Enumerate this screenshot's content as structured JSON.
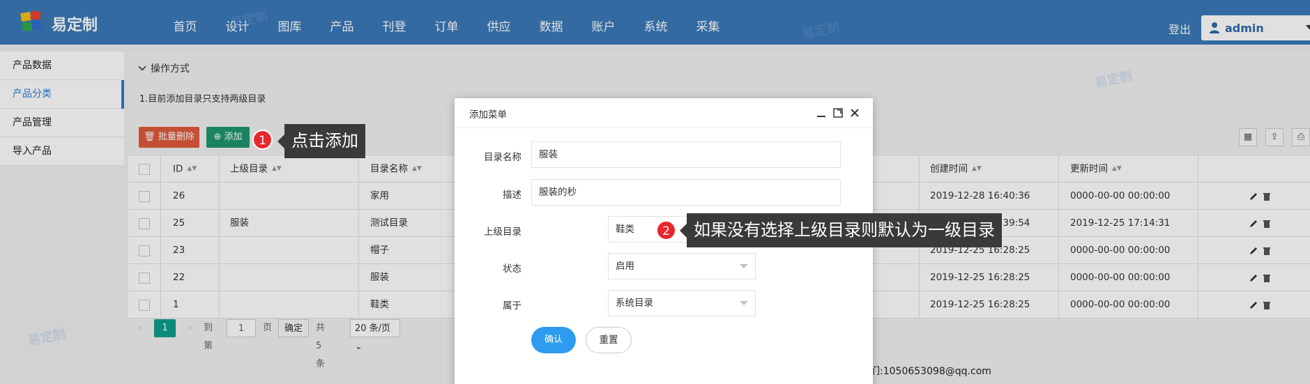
{
  "app": {
    "logo_text": "易定制"
  },
  "nav": {
    "items": [
      "首页",
      "设计",
      "图库",
      "产品",
      "刊登",
      "订单",
      "供应",
      "数据",
      "账户",
      "系统",
      "采集"
    ],
    "logout_label": "登出",
    "user_name": "admin"
  },
  "sidebar": {
    "items": [
      {
        "label": "产品数据"
      },
      {
        "label": "产品分类"
      },
      {
        "label": "产品管理"
      },
      {
        "label": "导入产品"
      }
    ]
  },
  "main": {
    "ops_title": "操作方式",
    "note": "1.目前添加目录只支持两级目录",
    "batch_delete_label": "批量删除",
    "add_label": "添加"
  },
  "table": {
    "headers": [
      "ID",
      "上级目录",
      "目录名称",
      "创建时间",
      "更新时间"
    ],
    "rows": [
      {
        "id": "26",
        "parent": "",
        "name": "家用",
        "created": "2019-12-28 16:40:36",
        "updated": "0000-00-00 00:00:00"
      },
      {
        "id": "25",
        "parent": "服装",
        "name": "测试目录",
        "created": "2019-12-25 16:39:54",
        "updated": "2019-12-25 17:14:31"
      },
      {
        "id": "23",
        "parent": "",
        "name": "帽子",
        "created": "2019-12-25 16:28:25",
        "updated": "0000-00-00 00:00:00"
      },
      {
        "id": "22",
        "parent": "",
        "name": "服装",
        "created": "2019-12-25 16:28:25",
        "updated": "0000-00-00 00:00:00"
      },
      {
        "id": "1",
        "parent": "",
        "name": "鞋类",
        "created": "2019-12-25 16:28:25",
        "updated": "0000-00-00 00:00:00"
      }
    ]
  },
  "pager": {
    "current_page": "1",
    "goto_label": "到第",
    "goto_value": "1",
    "page_unit": "页",
    "confirm_label": "确定",
    "total_label": "共 5 条",
    "per_page": "20 条/页"
  },
  "footer": {
    "contact": "们:1050653098@qq.com"
  },
  "modal": {
    "title": "添加菜单",
    "fields": {
      "name_label": "目录名称",
      "name_value": "服装",
      "desc_label": "描述",
      "desc_value": "服装的秒",
      "parent_label": "上级目录",
      "parent_value": "鞋类",
      "status_label": "状态",
      "status_value": "启用",
      "belong_label": "属于",
      "belong_value": "系统目录"
    },
    "confirm_label": "确认",
    "reset_label": "重置"
  },
  "callouts": {
    "step1_number": "1",
    "step1_text": "点击添加",
    "step2_number": "2",
    "step2_text": "如果没有选择上级目录则默认为一级目录"
  },
  "colors": {
    "nav_bg": "#3a79b8",
    "accent_blue": "#2d9bf0",
    "danger": "#e05b3c",
    "success": "#20966f",
    "badge_red": "#e8262d"
  }
}
